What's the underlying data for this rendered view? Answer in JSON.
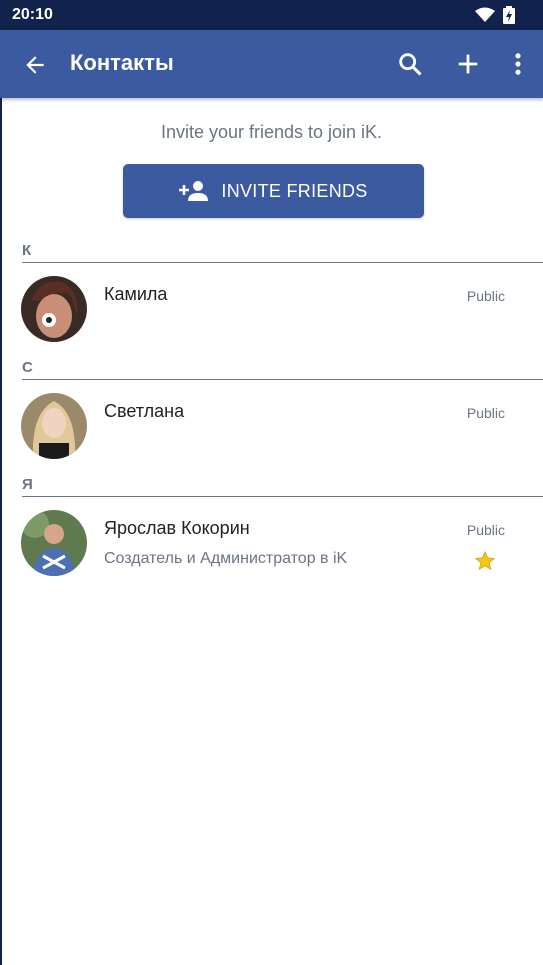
{
  "status_bar": {
    "time": "20:10"
  },
  "app_bar": {
    "title": "Контакты"
  },
  "invite": {
    "text": "Invite your friends to join iK.",
    "button_label": "INVITE FRIENDS"
  },
  "sections": [
    {
      "letter": "К",
      "contacts": [
        {
          "name": "Камила",
          "subtitle": "",
          "visibility": "Public",
          "starred": false
        }
      ]
    },
    {
      "letter": "С",
      "contacts": [
        {
          "name": "Светлана",
          "subtitle": "",
          "visibility": "Public",
          "starred": false
        }
      ]
    },
    {
      "letter": "Я",
      "contacts": [
        {
          "name": "Ярослав Кокорин",
          "subtitle": "Создатель и Администратор в iK",
          "visibility": "Public",
          "starred": true
        }
      ]
    }
  ],
  "colors": {
    "app_bar": "#3c5aa0",
    "status_bar": "#11224d",
    "secondary_text": "#6b7485",
    "star": "#f5c518"
  }
}
